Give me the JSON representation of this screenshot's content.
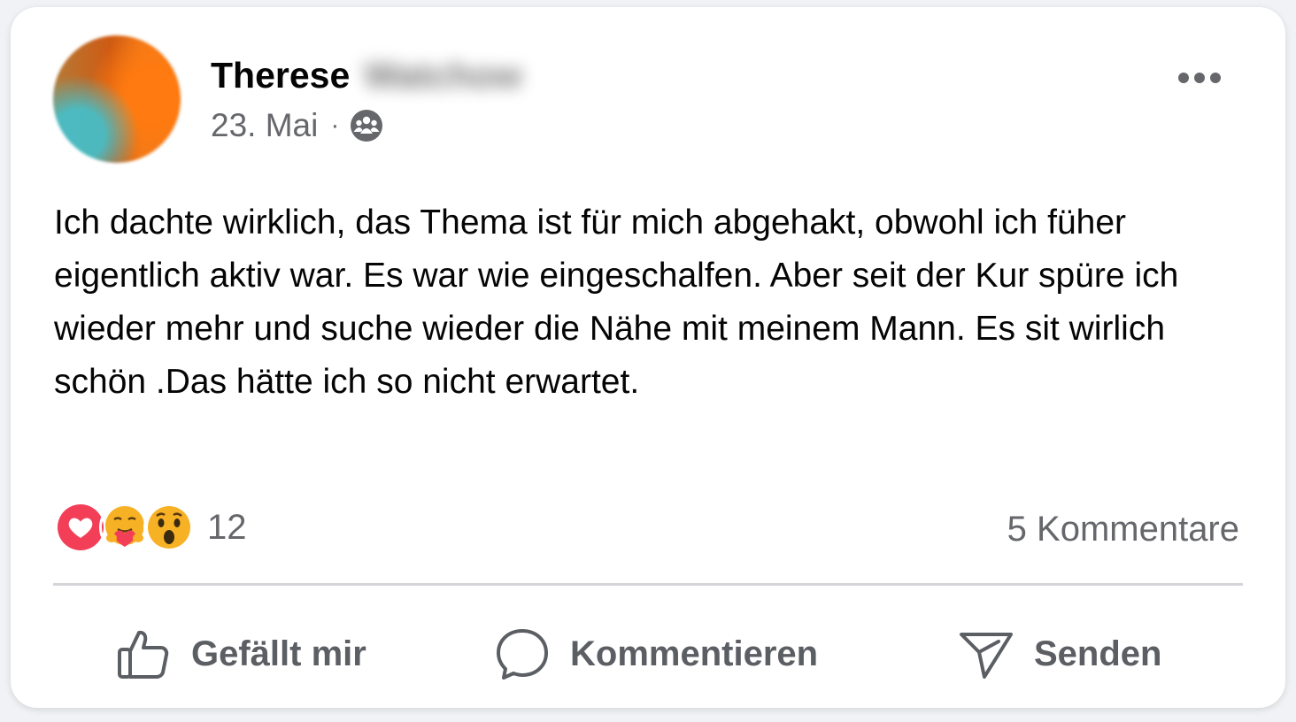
{
  "post": {
    "author_first_name": "Therese",
    "author_last_name_blurred": "Watchow",
    "date": "23. Mai",
    "separator": "·",
    "audience_icon": "group-icon",
    "more_icon": "more-horizontal-icon",
    "text": "Ich dachte wirklich, das Thema ist für mich abgehakt, obwohl ich füher eigentlich aktiv war. Es war wie eingeschalfen. Aber seit der Kur spüre ich wieder mehr und suche wieder die Nähe mit meinem Mann. Es sit wirlich schön .Das hätte ich so nicht erwartet."
  },
  "stats": {
    "reactions": [
      "love-reaction-icon",
      "care-reaction-icon",
      "wow-reaction-icon"
    ],
    "reaction_count": "12",
    "comments": "5 Kommentare"
  },
  "actions": {
    "like_label": "Gefällt mir",
    "comment_label": "Kommentieren",
    "send_label": "Senden"
  },
  "colors": {
    "text_primary": "#050505",
    "text_secondary": "#65676b",
    "love": "#f33e58",
    "emoji_yellow": "#f7b125",
    "divider": "#d3d5d9"
  }
}
